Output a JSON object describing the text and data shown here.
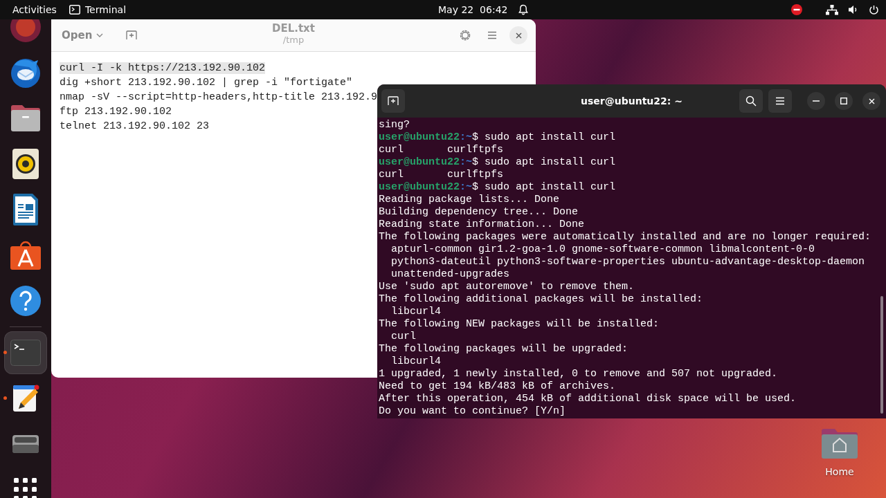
{
  "top_bar": {
    "activities": "Activities",
    "app_name": "Terminal",
    "clock": "May 22  06:42"
  },
  "dock": {
    "items": [
      {
        "kind": "partial",
        "running": false,
        "selected": false
      },
      {
        "kind": "mail",
        "running": false,
        "selected": false
      },
      {
        "kind": "files",
        "running": false,
        "selected": false
      },
      {
        "kind": "music",
        "running": false,
        "selected": false
      },
      {
        "kind": "writer",
        "running": false,
        "selected": false
      },
      {
        "kind": "store",
        "running": false,
        "selected": false
      },
      {
        "kind": "help",
        "running": false,
        "selected": false
      },
      {
        "kind": "terminal",
        "running": true,
        "selected": true
      },
      {
        "kind": "editor",
        "running": true,
        "selected": false
      },
      {
        "kind": "drive",
        "running": false,
        "selected": false
      },
      {
        "kind": "apps",
        "running": false,
        "selected": false
      }
    ]
  },
  "editor": {
    "open_button": "Open",
    "title": "DEL.txt",
    "subtitle": "/tmp",
    "lines": [
      {
        "text": "curl -I -k https://213.192.90.102",
        "highlighted": true
      },
      {
        "text": "dig +short 213.192.90.102 | grep -i \"fortigate\"",
        "highlighted": false
      },
      {
        "text": "nmap -sV --script=http-headers,http-title 213.192.9",
        "highlighted": false
      },
      {
        "text": "ftp 213.192.90.102",
        "highlighted": false
      },
      {
        "text": "telnet 213.192.90.102 23",
        "highlighted": false
      }
    ]
  },
  "terminal": {
    "title": "user@ubuntu22: ~",
    "lines": [
      {
        "kind": "output",
        "text": "sing?"
      },
      {
        "kind": "prompt",
        "user": "user@ubuntu22",
        "path": ":~",
        "command": "$ sudo apt install curl"
      },
      {
        "kind": "output",
        "text": "curl       curlftpfs"
      },
      {
        "kind": "prompt",
        "user": "user@ubuntu22",
        "path": ":~",
        "command": "$ sudo apt install curl"
      },
      {
        "kind": "output",
        "text": "curl       curlftpfs"
      },
      {
        "kind": "prompt",
        "user": "user@ubuntu22",
        "path": ":~",
        "command": "$ sudo apt install curl"
      },
      {
        "kind": "output",
        "text": "Reading package lists... Done"
      },
      {
        "kind": "output",
        "text": "Building dependency tree... Done"
      },
      {
        "kind": "output",
        "text": "Reading state information... Done"
      },
      {
        "kind": "output",
        "text": "The following packages were automatically installed and are no longer required:"
      },
      {
        "kind": "output",
        "text": "  apturl-common gir1.2-goa-1.0 gnome-software-common libmalcontent-0-0"
      },
      {
        "kind": "output",
        "text": "  python3-dateutil python3-software-properties ubuntu-advantage-desktop-daemon"
      },
      {
        "kind": "output",
        "text": "  unattended-upgrades"
      },
      {
        "kind": "output",
        "text": "Use 'sudo apt autoremove' to remove them."
      },
      {
        "kind": "output",
        "text": "The following additional packages will be installed:"
      },
      {
        "kind": "output",
        "text": "  libcurl4"
      },
      {
        "kind": "output",
        "text": "The following NEW packages will be installed:"
      },
      {
        "kind": "output",
        "text": "  curl"
      },
      {
        "kind": "output",
        "text": "The following packages will be upgraded:"
      },
      {
        "kind": "output",
        "text": "  libcurl4"
      },
      {
        "kind": "output",
        "text": "1 upgraded, 1 newly installed, 0 to remove and 507 not upgraded."
      },
      {
        "kind": "output",
        "text": "Need to get 194 kB/483 kB of archives."
      },
      {
        "kind": "output",
        "text": "After this operation, 454 kB of additional disk space will be used."
      },
      {
        "kind": "output",
        "text": "Do you want to continue? [Y/n]"
      }
    ]
  },
  "desktop_icons": [
    {
      "label": "Home"
    }
  ]
}
